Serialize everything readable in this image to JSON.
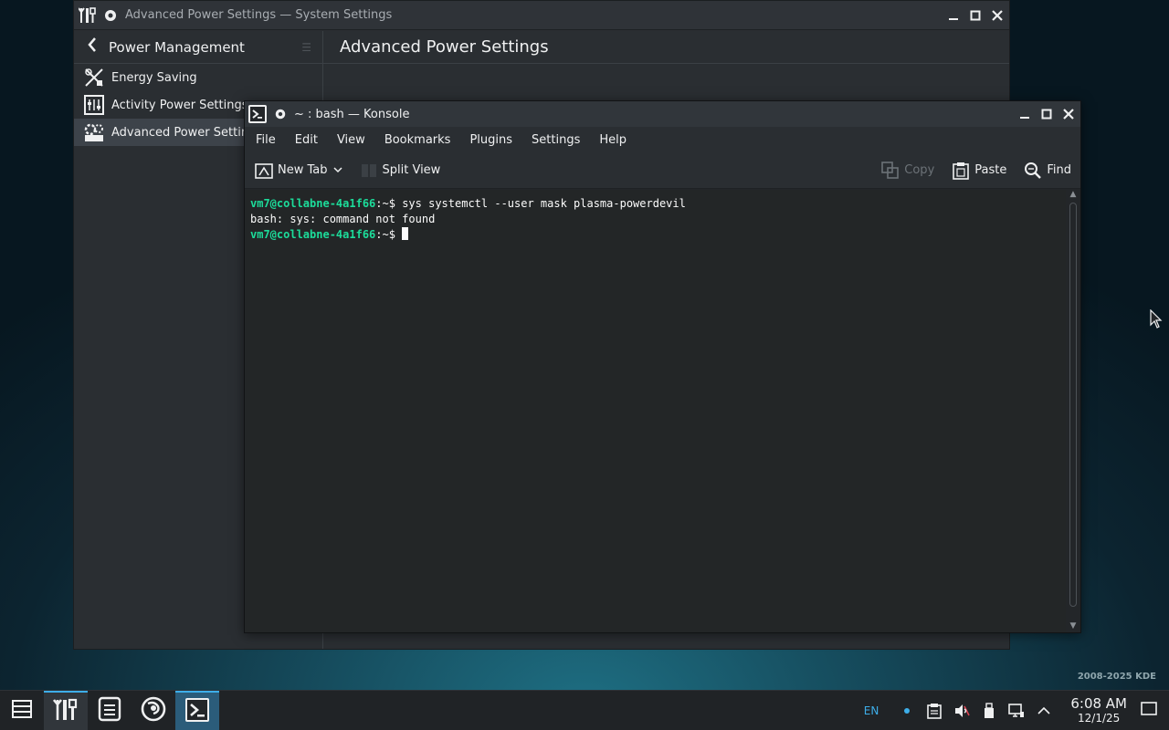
{
  "desktop": {
    "credit": "2008-2025 KDE"
  },
  "system_settings": {
    "window_title": "Advanced Power Settings — System Settings",
    "sidebar": {
      "back_label": "Power Management",
      "items": [
        {
          "label": "Energy Saving",
          "icon": "energy-saving-icon"
        },
        {
          "label": "Activity Power Settings",
          "icon": "activity-power-icon"
        },
        {
          "label": "Advanced Power Settings",
          "icon": "advanced-power-icon",
          "active": true
        }
      ]
    },
    "page_heading": "Advanced Power Settings"
  },
  "konsole": {
    "window_title": "~ : bash — Konsole",
    "menu": [
      "File",
      "Edit",
      "View",
      "Bookmarks",
      "Plugins",
      "Settings",
      "Help"
    ],
    "toolbar": {
      "new_tab": "New Tab",
      "split_view": "Split View",
      "copy": "Copy",
      "paste": "Paste",
      "find": "Find"
    },
    "terminal": {
      "prompt_user": "vm7@collabne-4a1f66",
      "prompt_path": ":~$",
      "line1_command": " sys systemctl --user mask plasma-powerdevil",
      "line2_output": "bash: sys: command not found",
      "line3_command": " "
    }
  },
  "taskbar": {
    "language": "EN",
    "time": "6:08 AM",
    "date": "12/1/25"
  },
  "colors": {
    "accent": "#3daee9",
    "prompt_green": "#1cdc9a"
  }
}
